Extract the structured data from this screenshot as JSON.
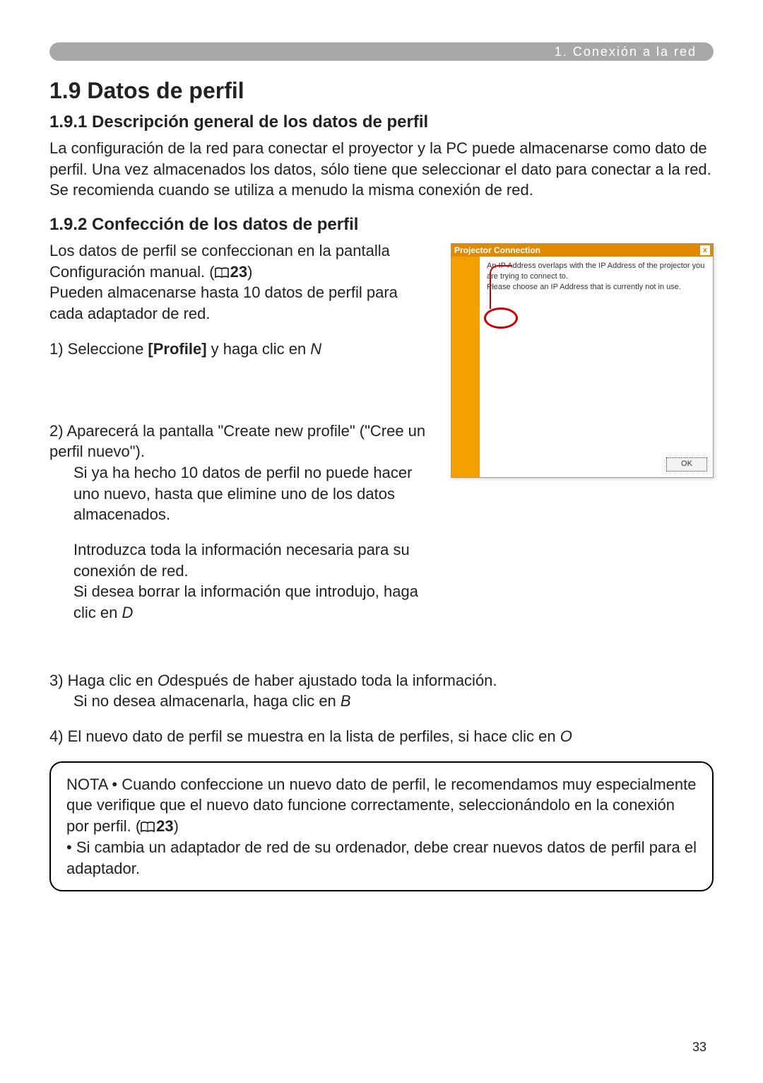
{
  "topbar": "1. Conexión a la red",
  "h1": "1.9 Datos de perfil",
  "s191_title": "1.9.1 Descripción general de los datos de perfil",
  "s191_p": "La configuración de la red para conectar el proyector y la PC puede almacenarse como dato de perfil. Una vez almacenados los datos, sólo tiene que seleccionar el dato para conectar a la red. Se recomienda cuando se utiliza a menudo la misma conexión de red.",
  "s192_title": "1.9.2 Confección de los datos de perfil",
  "s192_intro_a": "Los datos de perfil se confeccionan en la pantalla Configuración manual. (",
  "s192_ref1": "23",
  "s192_intro_b": ")\nPueden almacenarse hasta 10 datos de perfil para cada adaptador de red.",
  "step1_a": "1) Seleccione ",
  "step1_bold": "[Profile]",
  "step1_b": " y haga clic en ",
  "step1_c": "N",
  "step2_a": "2) Aparecerá la pantalla \"Create new profile\" (\"Cree un perfil nuevo\").",
  "step2_b": "Si ya ha hecho 10 datos de perfil no puede hacer uno nuevo, hasta que elimine uno de los datos almacenados.",
  "step2_c": "Introduzca toda la información necesaria para su conexión de red.",
  "step2_d": "Si desea borrar la información que introdujo, haga clic en ",
  "step2_e": "D",
  "step3_a": "3) Haga clic en ",
  "step3_b": "O",
  "step3_c": "después de haber ajustado toda la información.",
  "step3_d": "Si no desea almacenarla, haga clic en ",
  "step3_e": "B",
  "step4_a": "4) El nuevo dato de perfil se muestra en la lista de perfiles, si hace clic en ",
  "step4_b": "O",
  "note_a": "NOTA  • Cuando confeccione un nuevo dato de perfil, le recomendamos muy especialmente que verifique que el nuevo dato funcione correctamente, seleccionándolo en la conexión por perfil. (",
  "note_ref": "23",
  "note_b": ")",
  "note_c": "• Si cambia un adaptador de red de su ordenador, debe crear nuevos datos de perfil para el adaptador.",
  "dialog": {
    "title": "Projector Connection",
    "line1": "An IP Address overlaps with the IP Address of the projector you are trying to connect to.",
    "line2": "Please choose an IP Address that is currently not in use.",
    "ok": "OK",
    "close": "x"
  },
  "pagenum": "33"
}
